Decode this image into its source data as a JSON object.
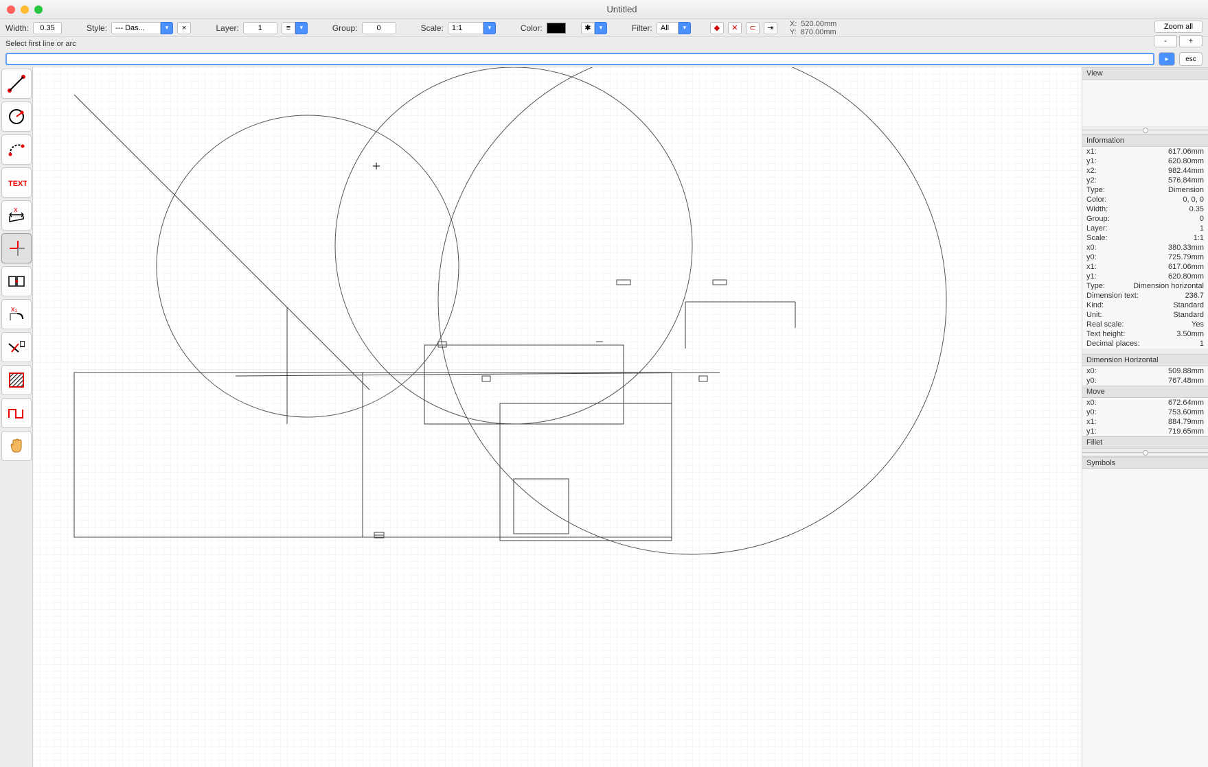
{
  "window": {
    "title": "Untitled"
  },
  "toolbar": {
    "width_label": "Width:",
    "width_value": "0.35",
    "style_label": "Style:",
    "style_value": "--- Das...",
    "style_clear": "×",
    "layer_label": "Layer:",
    "layer_value": "1",
    "group_label": "Group:",
    "group_value": "0",
    "scale_label": "Scale:",
    "scale_value": "1:1",
    "color_label": "Color:",
    "filter_label": "Filter:",
    "filter_value": "All",
    "x_label": "X:",
    "x_value": "520.00mm",
    "y_label": "Y:",
    "y_value": "870.00mm",
    "zoom_all": "Zoom all",
    "zoom_minus": "-",
    "zoom_plus": "+",
    "esc": "esc"
  },
  "prompt": "Select first line or arc",
  "tools": [
    {
      "name": "line-tool"
    },
    {
      "name": "circle-tool"
    },
    {
      "name": "arc-tool"
    },
    {
      "name": "text-tool"
    },
    {
      "name": "dimension-tool"
    },
    {
      "name": "corner-tool"
    },
    {
      "name": "move-tool"
    },
    {
      "name": "fillet-tool"
    },
    {
      "name": "trim-tool"
    },
    {
      "name": "hatch-tool"
    },
    {
      "name": "polyline-tool"
    },
    {
      "name": "pan-tool"
    }
  ],
  "rpanel": {
    "view": "View",
    "information": "Information",
    "info_rows": [
      {
        "k": "x1:",
        "v": "617.06mm"
      },
      {
        "k": "y1:",
        "v": "620.80mm"
      },
      {
        "k": "x2:",
        "v": "982.44mm"
      },
      {
        "k": "y2:",
        "v": "576.84mm"
      },
      {
        "k": "Type:",
        "v": "Dimension"
      },
      {
        "k": "Color:",
        "v": "0, 0, 0"
      },
      {
        "k": "Width:",
        "v": "0.35"
      },
      {
        "k": "Group:",
        "v": "0"
      },
      {
        "k": "Layer:",
        "v": "1"
      },
      {
        "k": "Scale:",
        "v": "1:1"
      },
      {
        "k": "x0:",
        "v": "380.33mm"
      },
      {
        "k": "y0:",
        "v": "725.79mm"
      },
      {
        "k": "x1:",
        "v": "617.06mm"
      },
      {
        "k": "y1:",
        "v": "620.80mm"
      },
      {
        "k": "Type:",
        "v": "Dimension horizontal"
      },
      {
        "k": "Dimension text:",
        "v": "236.7"
      },
      {
        "k": "Kind:",
        "v": "Standard"
      },
      {
        "k": "Unit:",
        "v": "Standard"
      },
      {
        "k": "Real scale:",
        "v": "Yes"
      },
      {
        "k": "Text height:",
        "v": "3.50mm"
      },
      {
        "k": "Decimal places:",
        "v": "1"
      }
    ],
    "dimh": "Dimension Horizontal",
    "dimh_rows": [
      {
        "k": "x0:",
        "v": "509.88mm"
      },
      {
        "k": "y0:",
        "v": "767.48mm"
      }
    ],
    "move": "Move",
    "move_rows": [
      {
        "k": "x0:",
        "v": "672.64mm"
      },
      {
        "k": "y0:",
        "v": "753.60mm"
      },
      {
        "k": "x1:",
        "v": "884.79mm"
      },
      {
        "k": "y1:",
        "v": "719.65mm"
      }
    ],
    "fillet": "Fillet",
    "symbols": "Symbols"
  }
}
